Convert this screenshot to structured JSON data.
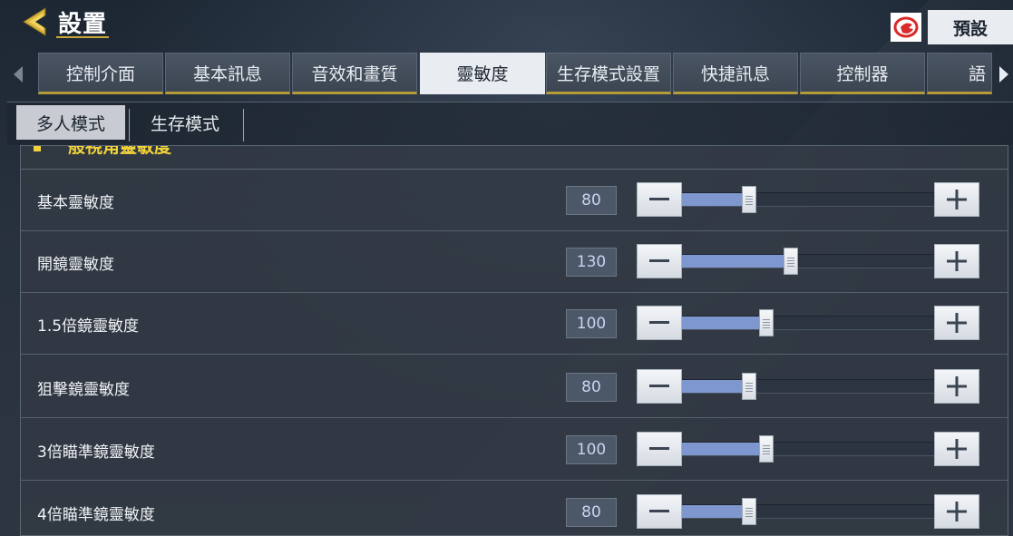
{
  "header": {
    "title": "設置",
    "back_icon": "back-arrow-icon",
    "logo_icon": "garena-logo-icon",
    "preset_label": "預設"
  },
  "tabs": [
    {
      "label": "控制介面",
      "active": false
    },
    {
      "label": "基本訊息",
      "active": false
    },
    {
      "label": "音效和畫質",
      "active": false
    },
    {
      "label": "靈敏度",
      "active": true
    },
    {
      "label": "生存模式設置",
      "active": false
    },
    {
      "label": "快捷訊息",
      "active": false
    },
    {
      "label": "控制器",
      "active": false
    },
    {
      "label": "語",
      "active": false
    }
  ],
  "subtabs": [
    {
      "label": "多人模式",
      "active": true
    },
    {
      "label": "生存模式",
      "active": false
    }
  ],
  "section": {
    "title": "般視角靈敏度"
  },
  "slider_max": 300,
  "rows": [
    {
      "label": "基本靈敏度",
      "value": "80"
    },
    {
      "label": "開鏡靈敏度",
      "value": "130"
    },
    {
      "label": "1.5倍鏡靈敏度",
      "value": "100"
    },
    {
      "label": "狙擊鏡靈敏度",
      "value": "80"
    },
    {
      "label": "3倍瞄準鏡靈敏度",
      "value": "100"
    },
    {
      "label": "4倍瞄準鏡靈敏度",
      "value": "80"
    }
  ],
  "colors": {
    "accent_gold": "#c9a739",
    "slider_fill": "#7e98cf",
    "section_title": "#f2d33a"
  }
}
